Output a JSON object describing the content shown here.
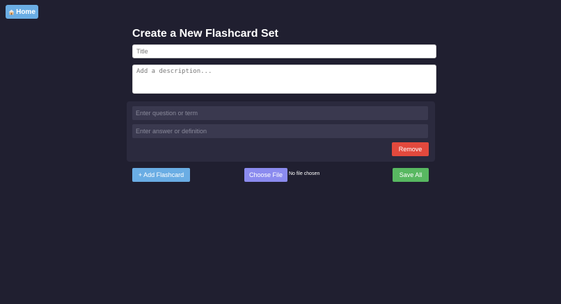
{
  "nav": {
    "home_label": "Home",
    "home_icon": "house-icon"
  },
  "form": {
    "heading": "Create a New Flashcard Set",
    "title_placeholder": "Title",
    "title_value": "",
    "description_placeholder": "Add a description...",
    "description_value": ""
  },
  "flashcards": [
    {
      "question_placeholder": "Enter question or term",
      "question_value": "",
      "answer_placeholder": "Enter answer or definition",
      "answer_value": "",
      "remove_label": "Remove"
    }
  ],
  "actions": {
    "add_label": "+ Add Flashcard",
    "choose_file_label": "Choose File",
    "file_status": "No file chosen",
    "save_label": "Save All"
  },
  "colors": {
    "background": "#201f30",
    "home_button": "#6aade4",
    "add_button": "#6aade4",
    "choose_file_button": "#8b8bef",
    "remove_button": "#e3493d",
    "save_button": "#58b861",
    "card_background": "#2b2a3e"
  }
}
